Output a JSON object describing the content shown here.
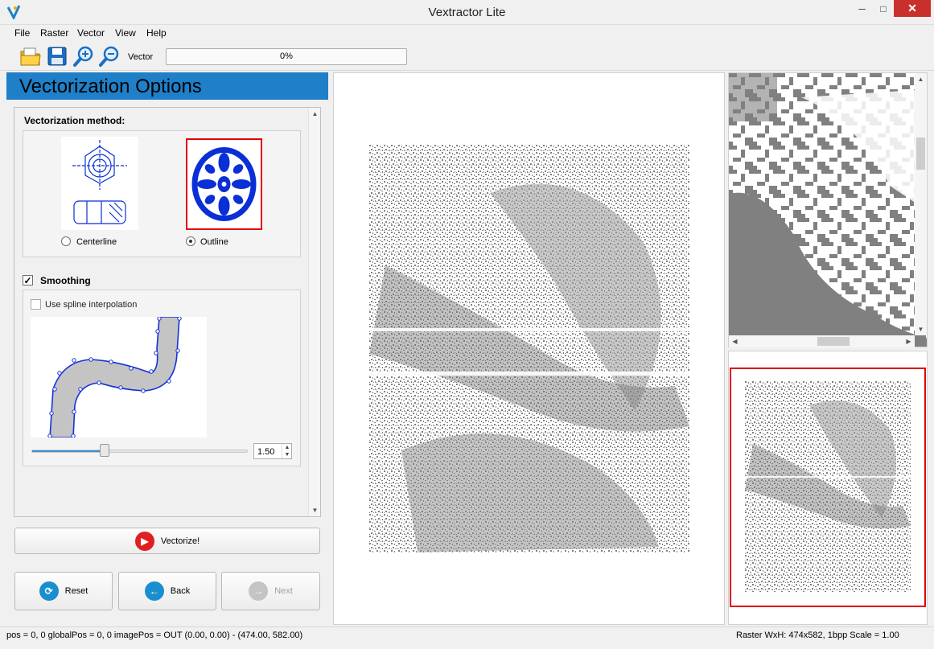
{
  "window": {
    "title": "Vextractor Lite",
    "controls": {
      "minimize": "─",
      "maximize": "□",
      "close": "✕"
    }
  },
  "menu": [
    "File",
    "Raster",
    "Vector",
    "View",
    "Help"
  ],
  "toolbar": {
    "icons": [
      "open-folder-icon",
      "save-disk-icon",
      "zoom-in-icon",
      "zoom-out-icon"
    ],
    "mode_label": "Vector",
    "progress": {
      "value": 0,
      "text": "0%"
    }
  },
  "options": {
    "header": "Vectorization Options",
    "method": {
      "title": "Vectorization method:",
      "choices": [
        {
          "label": "Centerline",
          "selected": false
        },
        {
          "label": "Outline",
          "selected": true
        }
      ]
    },
    "smoothing": {
      "label": "Smoothing",
      "checked": true,
      "spline_label": "Use spline interpolation",
      "spline_checked": false,
      "slider": {
        "fraction": 0.34
      },
      "spin_value": "1.50"
    },
    "buttons": {
      "vectorize": "Vectorize!",
      "reset": "Reset",
      "back": "Back",
      "next": "Next"
    }
  },
  "colors": {
    "header_blue": "#1f7fc8",
    "selection_red": "#e00000",
    "raster_gray": "#808080",
    "icon_blue": "#0a2fd6"
  },
  "status": {
    "left": "pos = 0, 0  globalPos = 0, 0  imagePos = OUT  (0.00, 0.00) - (474.00, 582.00)",
    "right": "Raster WxH: 474x582, 1bpp  Scale = 1.00"
  }
}
